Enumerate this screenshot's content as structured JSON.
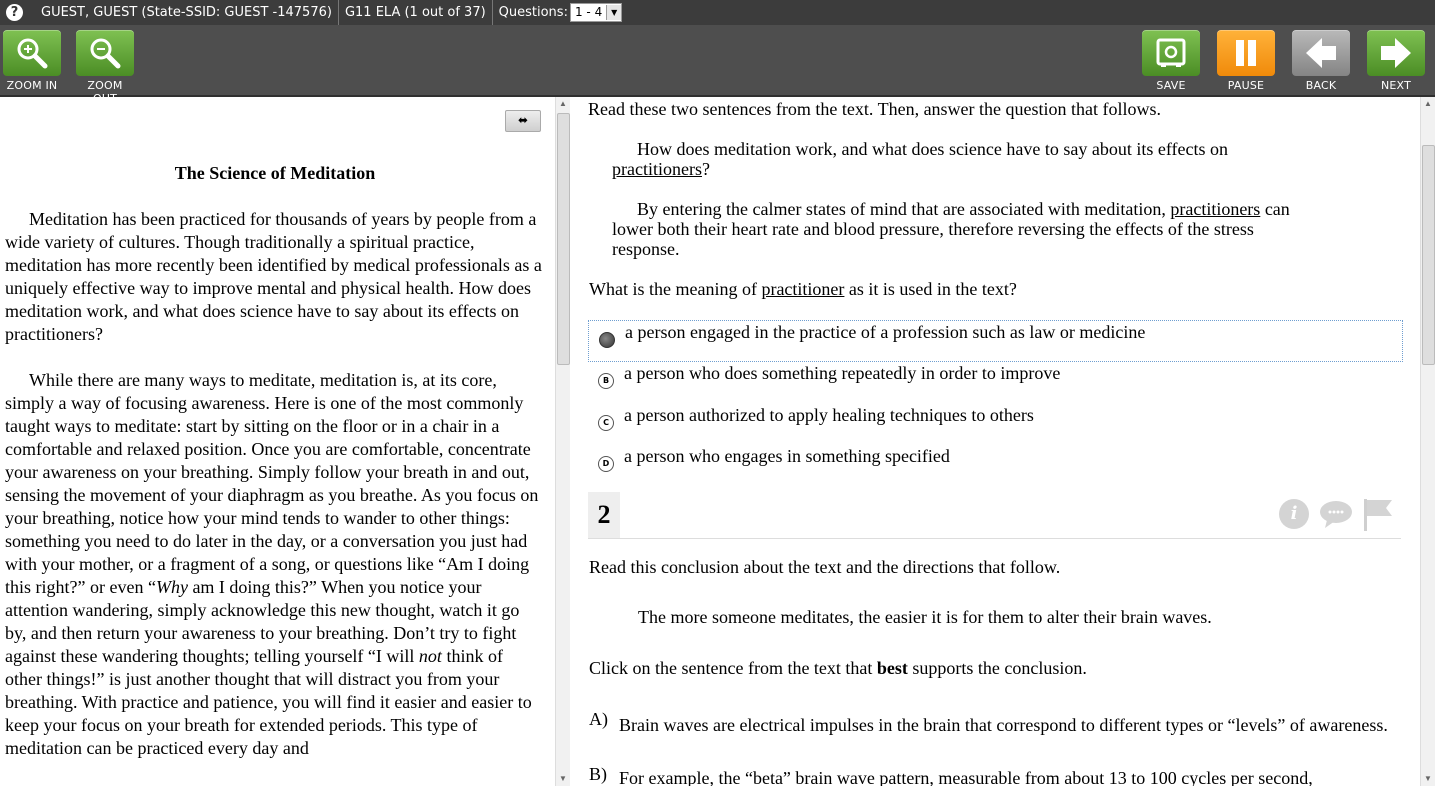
{
  "infobar": {
    "help_glyph": "?",
    "student": "GUEST, GUEST (State-SSID: GUEST -147576)",
    "test": "G11 ELA (1 out of 37)",
    "questions_label": "Questions:",
    "questions_value": "1 - 4"
  },
  "toolbar": {
    "zoom_in": "ZOOM IN",
    "zoom_out": "ZOOM OUT",
    "save": "SAVE",
    "pause": "PAUSE",
    "back": "BACK",
    "next": "NEXT"
  },
  "passage": {
    "title": "The Science of Meditation",
    "p1": "Meditation has been practiced for thousands of years by people from a wide variety of cultures. Though traditionally a spiritual practice, meditation has more recently been identified by medical professionals as a uniquely effective way to improve mental and physical health. How does meditation work, and what does science have to say about its effects on practitioners?",
    "p2_a": "While there are many ways to meditate, meditation is, at its core, simply a way of focusing awareness. Here is one of the most commonly taught ways to meditate: start by sitting on the floor or in a chair in a comfortable and relaxed position. Once you are comfortable, concentrate your awareness on your breathing. Simply follow your breath in and out, sensing the movement of your diaphragm as you breathe. As you focus on your breathing, notice how your mind tends to wander to other things: something you need to do later in the day, or a conversation you just had with your mother, or a fragment of a song, or questions like “Am I doing this right?” or even “",
    "p2_why": "Why",
    "p2_b": " am I doing this?” When you notice your attention wandering, simply acknowledge this new thought, watch it go by, and then return your awareness to your breathing. Don’t try to fight against these wandering thoughts; telling yourself “I will ",
    "p2_not": "not",
    "p2_c": " think of other things!” is just another thought that will distract you from your breathing. With practice and patience, you will find it easier and easier to keep your focus on your breath for extended periods. This type of meditation can be practiced every day and"
  },
  "q1": {
    "prompt": "Read these two sentences from the text. Then, answer the question that follows.",
    "s1_a": "How does meditation work, and what does science have to say about its effects on",
    "s1_u": "practitioners",
    "s1_b": "?",
    "s2_a": "By entering the calmer states of mind that are associated with meditation,",
    "s2_u": "practitioners",
    "s2_b": "can lower both their heart rate and blood pressure, therefore reversing the effects of the stress response.",
    "question_a": "What is the meaning of",
    "question_u": "practitioner",
    "question_b": "as it is used in the text?",
    "options": [
      {
        "letter": "A",
        "text": "a person engaged in the practice of a profession such as law or medicine"
      },
      {
        "letter": "B",
        "text": "a person who does something repeatedly in order to improve"
      },
      {
        "letter": "C",
        "text": "a person authorized to apply healing techniques to others"
      },
      {
        "letter": "D",
        "text": "a person who engages in something specified"
      }
    ],
    "selected": "A"
  },
  "q2": {
    "number": "2",
    "prompt": "Read this conclusion about the text and the directions that follow.",
    "conclusion": "The more someone meditates, the easier it is for them to alter their brain waves.",
    "instruction_a": "Click on the sentence from the text that",
    "instruction_bold": "best",
    "instruction_b": "supports the conclusion.",
    "answers": [
      {
        "label": "A)",
        "text": "Brain waves are electrical impulses in the brain that correspond to different types or “levels” of awareness."
      },
      {
        "label": "B)",
        "text": "For example, the “beta” brain wave pattern, measurable from about 13 to 100 cycles per second,"
      }
    ],
    "info_glyph": "i"
  },
  "icons": {
    "help": "help-icon",
    "zoom_in": "magnifier-plus-icon",
    "zoom_out": "magnifier-minus-icon",
    "save": "safe-icon",
    "pause": "pause-icon",
    "back": "arrow-left-icon",
    "next": "arrow-right-icon",
    "info": "info-icon",
    "comment": "comment-bubble-icon",
    "flag": "flag-icon"
  },
  "colors": {
    "topbar": "#3c3c3c",
    "toolbar": "#4e4e4e",
    "green_button": "#5fa237",
    "orange_button": "#f7a023",
    "grey_button": "#9e9e9e"
  }
}
